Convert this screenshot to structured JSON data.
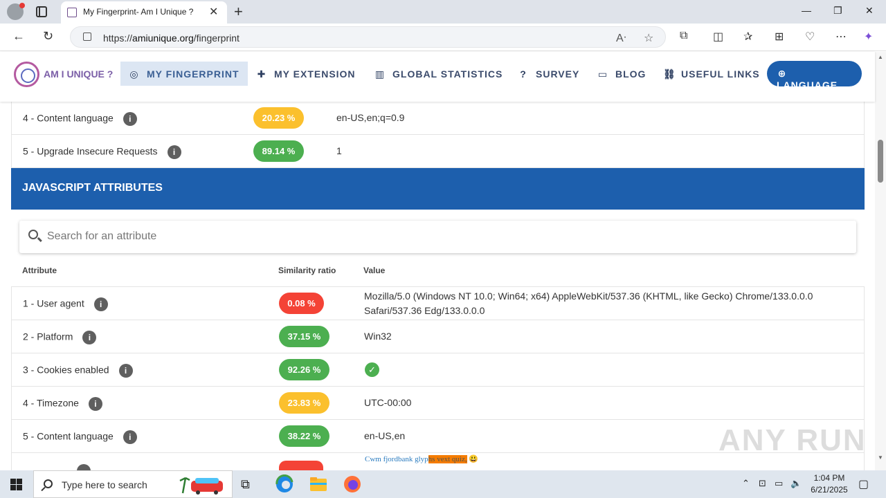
{
  "browser": {
    "tab_title": "My Fingerprint- Am I Unique ?",
    "url_prefix": "https://",
    "url_host": "amiunique.org",
    "url_path": "/fingerprint"
  },
  "site": {
    "logo_text": "AM I UNIQUE ?",
    "nav": [
      {
        "label": "MY FINGERPRINT",
        "icon": "fingerprint-icon"
      },
      {
        "label": "MY EXTENSION",
        "icon": "puzzle-icon"
      },
      {
        "label": "GLOBAL STATISTICS",
        "icon": "bar-chart-icon"
      },
      {
        "label": "SURVEY",
        "icon": "help-circle-icon"
      },
      {
        "label": "BLOG",
        "icon": "blog-icon"
      },
      {
        "label": "USEFUL LINKS",
        "icon": "link-icon"
      }
    ],
    "language_label": "LANGUAGE"
  },
  "http_rows": [
    {
      "name": "4 - Content language",
      "ratio": "20.23 %",
      "ratio_color": "#fbc02d",
      "value": "en-US,en;q=0.9"
    },
    {
      "name": "5 - Upgrade Insecure Requests",
      "ratio": "89.14 %",
      "ratio_color": "#4caf50",
      "value": "1"
    }
  ],
  "js_section": {
    "title": "JAVASCRIPT ATTRIBUTES",
    "search_placeholder": "Search for an attribute",
    "columns": [
      "Attribute",
      "Similarity ratio",
      "Value"
    ],
    "rows": [
      {
        "name": "1 - User agent",
        "ratio": "0.08 %",
        "ratio_color": "#f44336",
        "value_line1": "Mozilla/5.0 (Windows NT 10.0; Win64; x64) AppleWebKit/537.36 (KHTML, like Gecko) Chrome/133.0.0.0",
        "value_line2": "Safari/537.36 Edg/133.0.0.0"
      },
      {
        "name": "2 - Platform",
        "ratio": "37.15 %",
        "ratio_color": "#4caf50",
        "value_line1": "Win32"
      },
      {
        "name": "3 - Cookies enabled",
        "ratio": "92.26 %",
        "ratio_color": "#4caf50",
        "value_icon": "check-circle-icon"
      },
      {
        "name": "4 - Timezone",
        "ratio": "23.83 %",
        "ratio_color": "#fbc02d",
        "value_line1": "UTC-00:00"
      },
      {
        "name": "5 - Content language",
        "ratio": "38.22 %",
        "ratio_color": "#4caf50",
        "value_line1": "en-US,en"
      }
    ],
    "partial_canvas_text_a": "Cwm fjordbank glyp",
    "partial_canvas_text_b": "hs vext quiz,",
    "partial_canvas_emoji": "😃"
  },
  "watermark": "ANY RUN",
  "taskbar": {
    "search_placeholder": "Type here to search",
    "time": "1:04 PM",
    "date": "6/21/2025"
  }
}
